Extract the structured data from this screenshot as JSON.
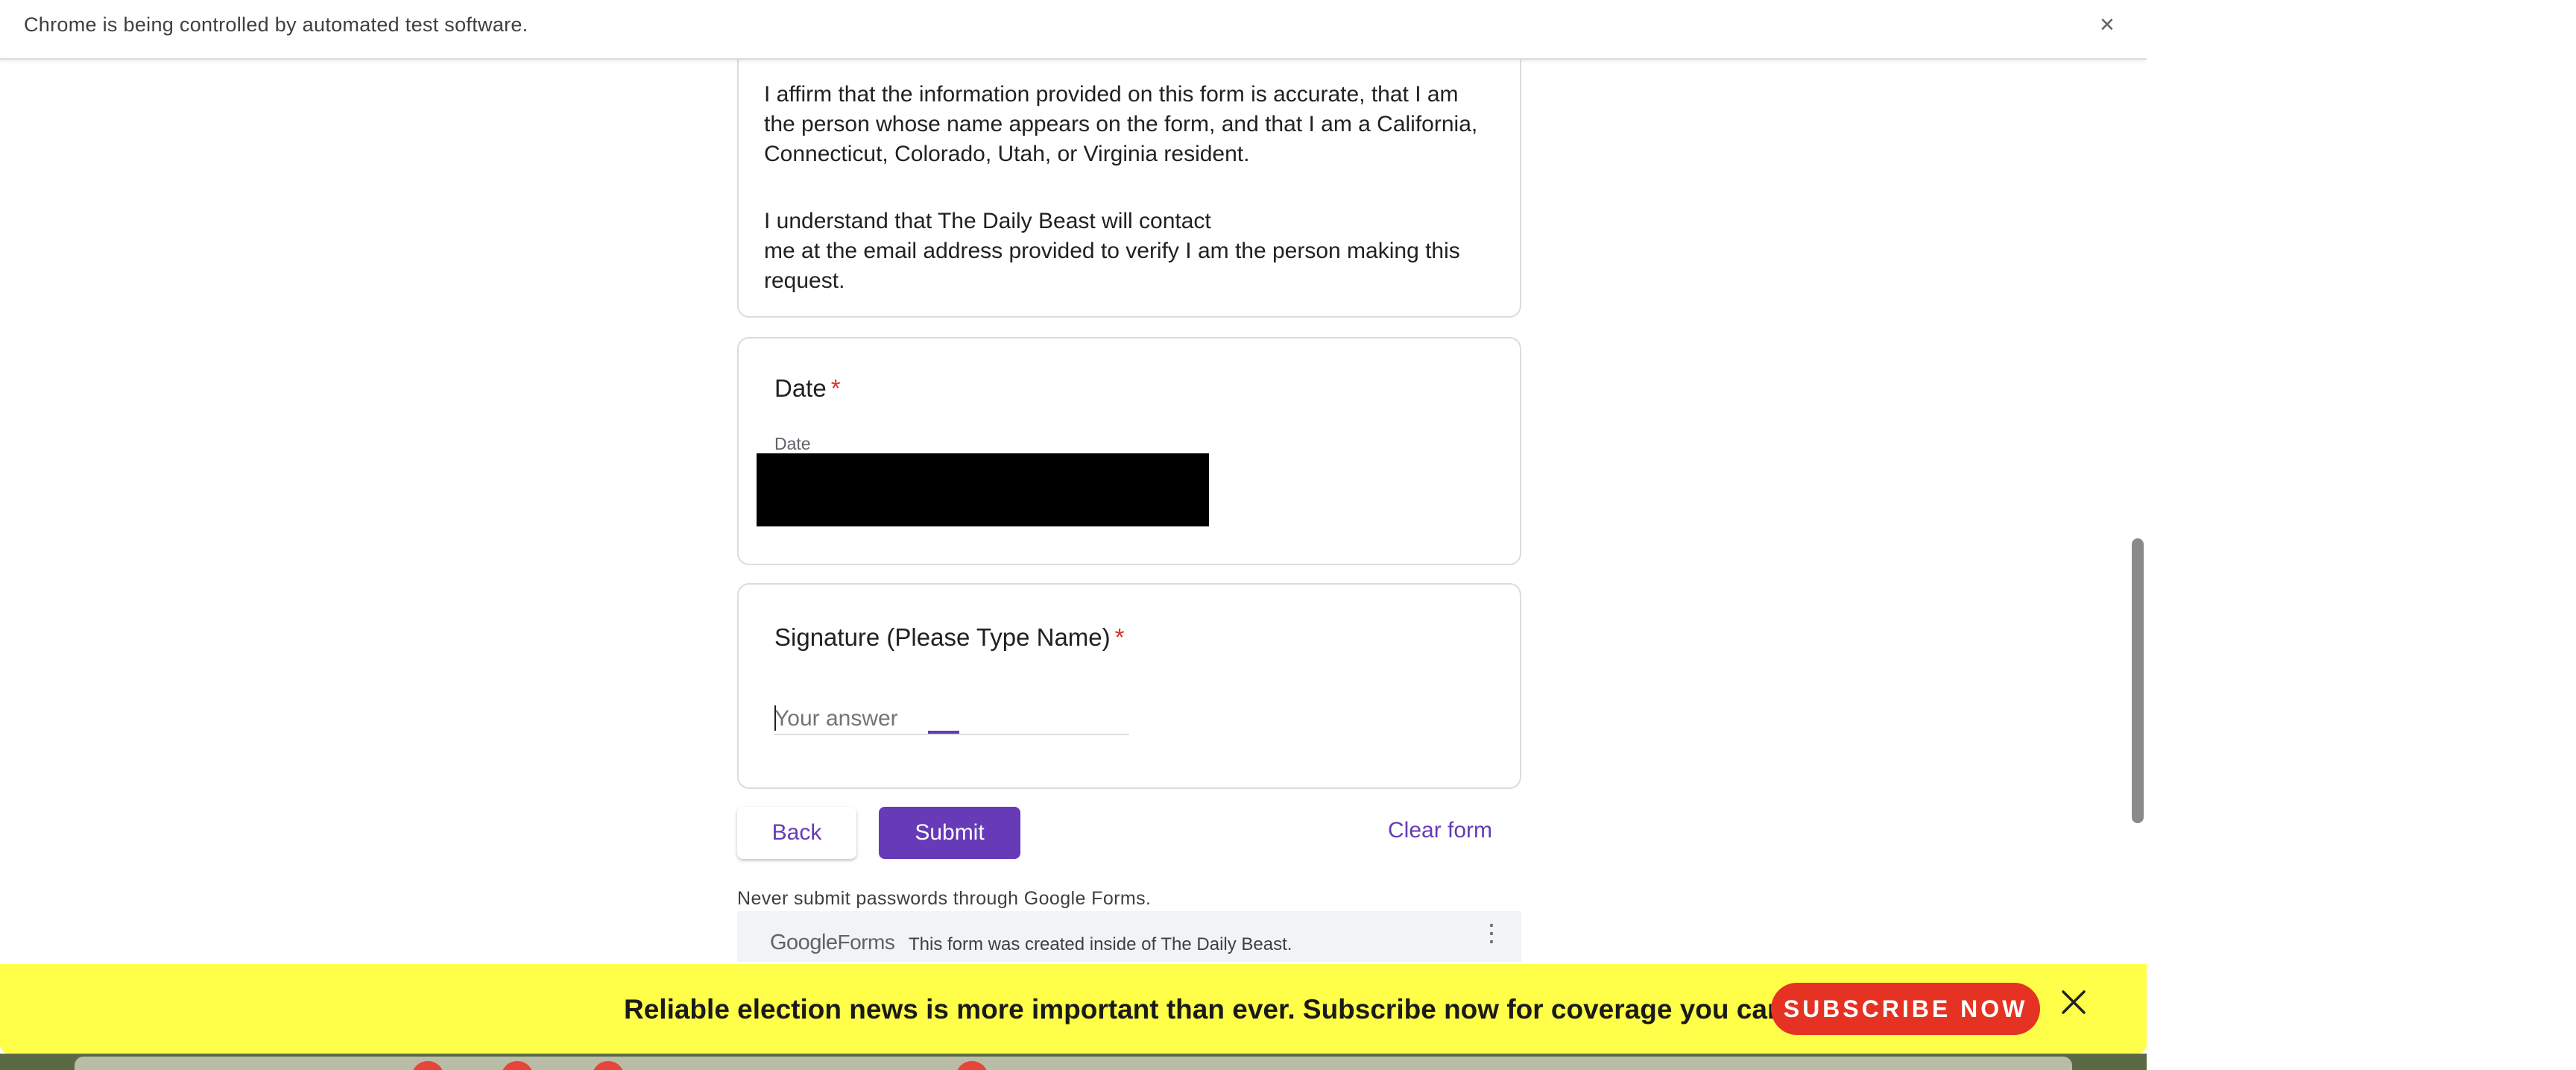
{
  "browser": {
    "infobar_text": "Chrome is being controlled by automated test software.",
    "close_glyph": "×"
  },
  "form": {
    "affirm_paragraph": "I affirm that the information provided on this form is accurate, that I am the person whose name appears on the form, and that I am a California, Connecticut, Colorado, Utah, or Virginia resident.",
    "understand_paragraph_line1": "I understand that The Daily Beast will contact",
    "understand_paragraph_line2": "me at the email address provided to verify I am the person making this request.",
    "date_question": {
      "title": "Date",
      "required_mark": "*",
      "sub_label": "Date"
    },
    "signature_question": {
      "title": "Signature (Please Type Name)",
      "required_mark": "*",
      "placeholder": "Your answer"
    },
    "buttons": {
      "back": "Back",
      "submit": "Submit",
      "clear": "Clear form"
    },
    "warning": "Never submit passwords through Google Forms.",
    "footer": {
      "logo_google": "Google",
      "logo_forms": "Forms",
      "text": "This form was created inside of The Daily Beast.",
      "more_glyph": "⋮"
    },
    "colors": {
      "accent": "#673ab7",
      "required": "#d93025"
    }
  },
  "promo": {
    "text": "Reliable election news is more important than ever. Subscribe now for coverage you can count on.",
    "button": "SUBSCRIBE NOW",
    "background": "#ffff49",
    "button_color": "#e53222"
  }
}
